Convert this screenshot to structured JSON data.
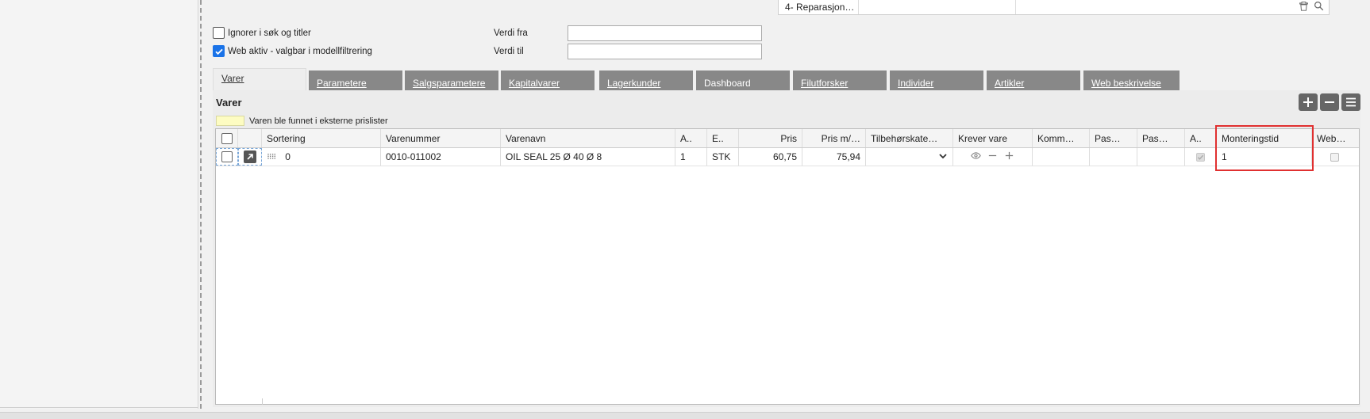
{
  "top_row": {
    "cell1": "4- Reparasjon…"
  },
  "checkboxes": [
    {
      "label": "Ignorer i søk og titler",
      "checked": false
    },
    {
      "label": "Web aktiv - valgbar i modellfiltrering",
      "checked": true
    }
  ],
  "fields": {
    "verdi_fra": {
      "label": "Verdi fra",
      "value": ""
    },
    "verdi_til": {
      "label": "Verdi til",
      "value": ""
    }
  },
  "tabs": [
    {
      "label": "Varer",
      "active": true
    },
    {
      "label": "Parametere"
    },
    {
      "label": "Salgsparametere"
    },
    {
      "label": "Kapitalvarer"
    },
    {
      "label": "Lagerkunder"
    },
    {
      "label": "Dashboard"
    },
    {
      "label": "Filutforsker"
    },
    {
      "label": "Individer"
    },
    {
      "label": "Artikler"
    },
    {
      "label": "Web beskrivelse"
    }
  ],
  "panel": {
    "title": "Varer",
    "legend": "Varen ble funnet i eksterne prislister"
  },
  "grid": {
    "columns": [
      "Sortering",
      "Varenummer",
      "Varenavn",
      "A..",
      "E..",
      "Pris",
      "Pris m/…",
      "Tilbehørskate…",
      "Krever vare",
      "Komm…",
      "Pas…",
      "Pas…",
      "A..",
      "Monteringstid",
      "Web…"
    ],
    "rows": [
      {
        "sortering": "0",
        "varenummer": "0010-011002",
        "varenavn": "OIL SEAL 25 Ø 40 Ø 8",
        "a": "1",
        "e": "STK",
        "pris": "60,75",
        "pris_m": "75,94",
        "tilbehor": "",
        "komm": "",
        "pas1": "",
        "pas2": "",
        "monteringstid": "1"
      }
    ]
  },
  "colors": {
    "accent": "#1a73e8",
    "tab_inactive": "#888888",
    "highlight": "#e03030",
    "legend_swatch": "#fdfcc2"
  }
}
